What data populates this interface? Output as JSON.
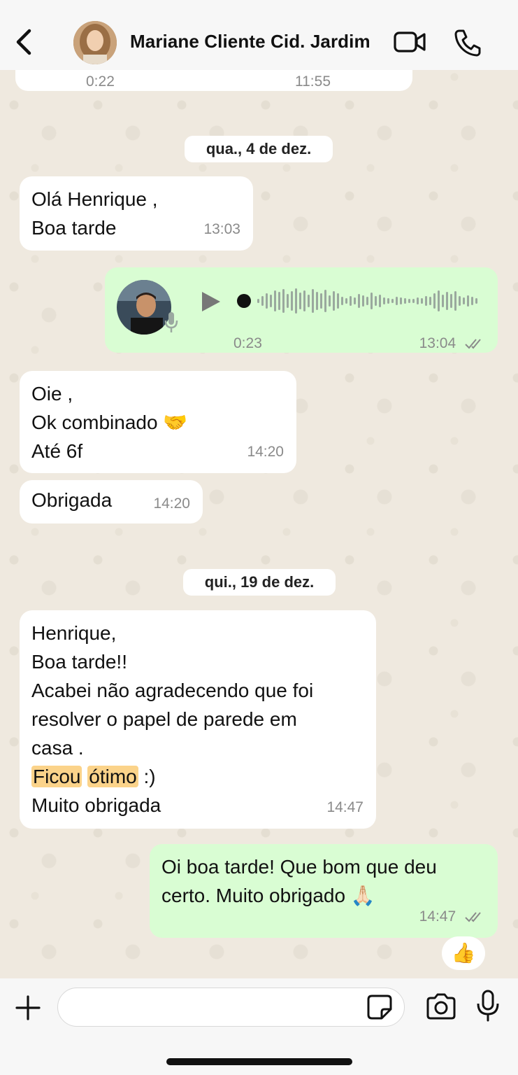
{
  "header": {
    "contact_name": "Mariane Cliente Cid. Jardim"
  },
  "top_partial": {
    "left_duration": "0:22",
    "time": "11:55"
  },
  "dates": [
    "qua., 4 de dez.",
    "qui., 19 de dez."
  ],
  "messages": [
    {
      "dir": "in",
      "lines": [
        "Olá Henrique ,",
        "Boa tarde"
      ],
      "time": "13:03"
    },
    {
      "dir": "out",
      "type": "voice",
      "duration": "0:23",
      "time": "13:04"
    },
    {
      "dir": "in",
      "lines": [
        "Oie ,",
        "Ok combinado 🤝",
        "Até 6f"
      ],
      "time": "14:20"
    },
    {
      "dir": "in",
      "lines": [
        "Obrigada"
      ],
      "time": "14:20"
    },
    {
      "dir": "in",
      "lines": [
        "Henrique,",
        "Boa tarde!!",
        "Acabei não agradecendo que foi",
        "resolver o papel de parede em",
        "casa ."
      ],
      "hl1": "Ficou",
      "hl2": "ótimo",
      "hl_tail": " :)",
      "last_line": "Muito obrigada",
      "time": "14:47"
    },
    {
      "dir": "out",
      "lines": [
        "Oi boa tarde! Que bom que deu",
        "certo. Muito obrigado 🙏🏻"
      ],
      "time": "14:47",
      "reaction": "👍"
    }
  ],
  "colors": {
    "incoming": "#ffffff",
    "outgoing": "#d9fdd3",
    "highlight": "#fbd38a",
    "tick": "#8a8a8a"
  }
}
